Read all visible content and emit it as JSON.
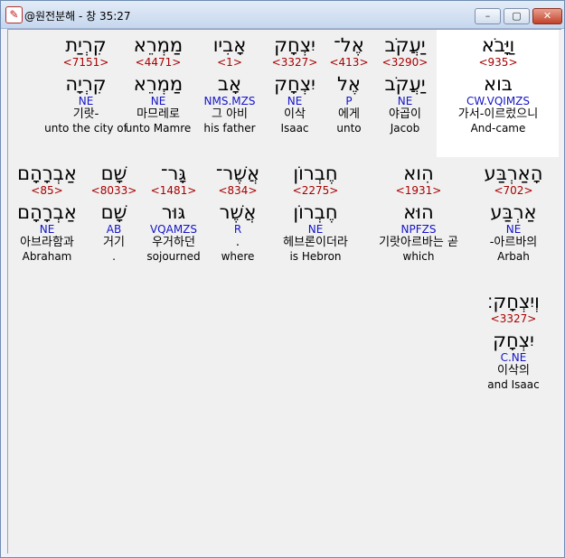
{
  "window": {
    "title": "@원전분해 - 창 35:27",
    "buttons": {
      "minimize": "–",
      "maximize": "▢",
      "close": "✕"
    }
  },
  "rows": [
    {
      "words": [
        {
          "heb": "קִרְיַת",
          "strong": "<7151>",
          "root": "קִרְיָה",
          "gram": "NE",
          "kor": "기랏-",
          "eng": "unto the city of"
        },
        {
          "heb": "מַמְרֵא",
          "strong": "<4471>",
          "root": "מַמְרֵא",
          "gram": "NE",
          "kor": "마므레로",
          "eng": "unto Mamre"
        },
        {
          "heb": "אָבִיו",
          "strong": "<1>",
          "root": "אָב",
          "gram": "NMS.MZS",
          "kor": "그 아비",
          "eng": "his father"
        },
        {
          "heb": "יִצְחָק",
          "strong": "<3327>",
          "root": "יִצְחָק",
          "gram": "NE",
          "kor": "이삭",
          "eng": "Isaac"
        },
        {
          "heb": "אֶל־",
          "strong": "<413>",
          "root": "אֶל",
          "gram": "P",
          "kor": "에게",
          "eng": "unto"
        },
        {
          "heb": "יַעֲקֹב",
          "strong": "<3290>",
          "root": "יַעֲקֹב",
          "gram": "NE",
          "kor": "야곱이",
          "eng": "Jacob"
        },
        {
          "heb": "וַיָּבֹא",
          "strong": "<935>",
          "root": "בּוא",
          "gram": "CW.VQIMZS",
          "kor": "가서-이르렀으니",
          "eng": "And-came"
        }
      ]
    },
    {
      "words": [
        {
          "heb": "אַבְרָהָם",
          "strong": "<85>",
          "root": "אַבְרָהָם",
          "gram": "NE",
          "kor": "아브라함과",
          "eng": "Abraham"
        },
        {
          "heb": "שָׁם",
          "strong": "<8033>",
          "root": "שָׁם",
          "gram": "AB",
          "kor": "거기",
          "eng": "."
        },
        {
          "heb": "גָּר־",
          "strong": "<1481>",
          "root": "גּוּר",
          "gram": "VQAMZS",
          "kor": "우거하던",
          "eng": "sojourned"
        },
        {
          "heb": "אֲשֶׁר־",
          "strong": "<834>",
          "root": "אֲשֶׁר",
          "gram": "R",
          "kor": ".",
          "eng": "where"
        },
        {
          "heb": "חֶבְרוֹן",
          "strong": "<2275>",
          "root": "חֶבְרוֹן",
          "gram": "NE",
          "kor": "헤브론이더라",
          "eng": "is Hebron"
        },
        {
          "heb": "הִוא",
          "strong": "<1931>",
          "root": "הוּא",
          "gram": "NPFZS",
          "kor": "기랏아르바는 곧",
          "eng": "which"
        },
        {
          "heb": "הָאַרְבַּע",
          "strong": "<702>",
          "root": "אַרְבַּע",
          "gram": "NE",
          "kor": "-아르바의",
          "eng": "Arbah"
        }
      ]
    },
    {
      "words": [
        {
          "heb": "וְיִצְחָק׃",
          "strong": "<3327>",
          "root": "יִצְחָק",
          "gram": "C.NE",
          "kor": "이삭의",
          "eng": "and Isaac"
        }
      ]
    }
  ]
}
